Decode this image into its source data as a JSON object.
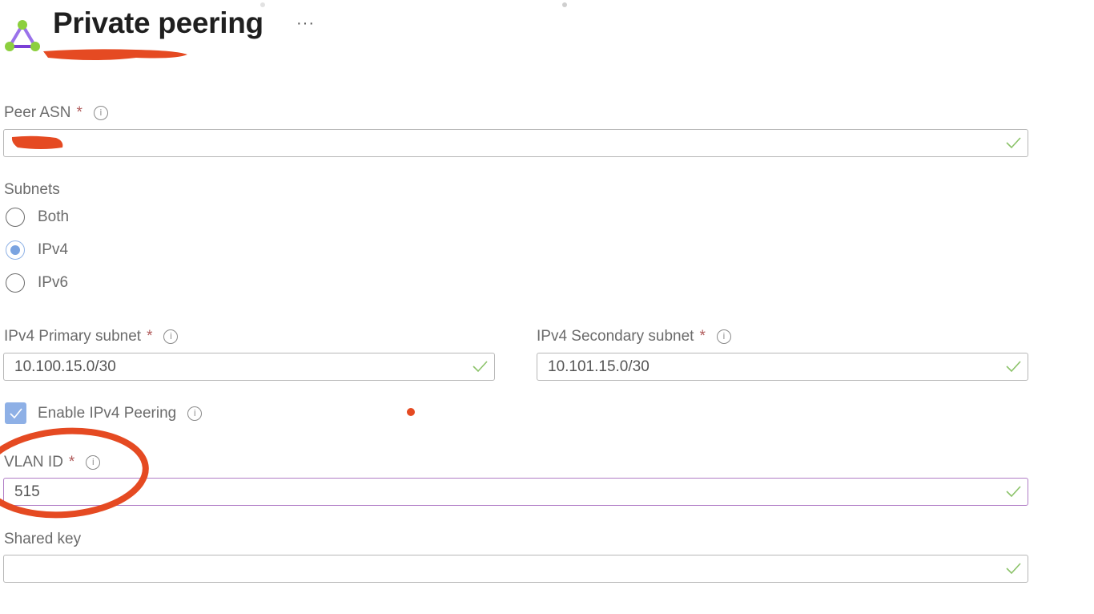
{
  "header": {
    "title": "Private peering",
    "more_label": "···",
    "icon": "peering-triangle-icon"
  },
  "form": {
    "peer_asn": {
      "label": "Peer ASN",
      "required": "*",
      "info": "i",
      "value": ""
    },
    "subnets": {
      "label": "Subnets",
      "options": [
        {
          "label": "Both",
          "selected": false
        },
        {
          "label": "IPv4",
          "selected": true
        },
        {
          "label": "IPv6",
          "selected": false
        }
      ]
    },
    "ipv4_primary": {
      "label": "IPv4 Primary subnet",
      "required": "*",
      "info": "i",
      "value": "10.100.15.0/30"
    },
    "ipv4_secondary": {
      "label": "IPv4 Secondary subnet",
      "required": "*",
      "info": "i",
      "value": "10.101.15.0/30"
    },
    "enable_ipv4": {
      "label": "Enable IPv4 Peering",
      "checked": true,
      "info": "i"
    },
    "vlan_id": {
      "label": "VLAN ID",
      "required": "*",
      "info": "i",
      "value": "515"
    },
    "shared_key": {
      "label": "Shared key",
      "value": ""
    }
  },
  "colors": {
    "valid_check": "#8cc36a",
    "required_star": "#b05a5a",
    "radio_selected": "#7aa3e0",
    "focus_border": "#b07cc6",
    "annotation_red": "#e54a22"
  }
}
